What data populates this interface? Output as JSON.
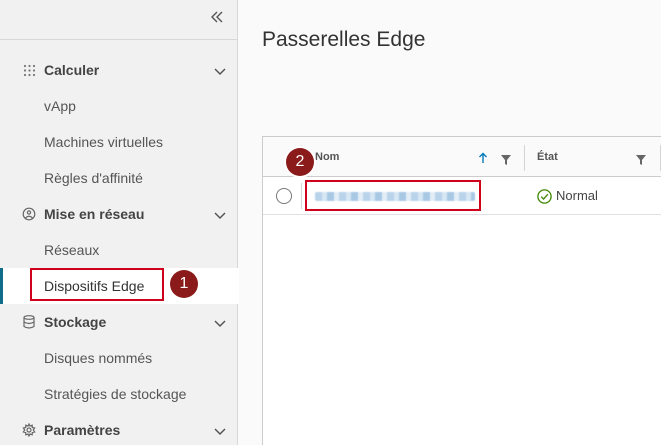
{
  "sidebar": {
    "collapse_icon": "double-chevron-left-icon",
    "groups": [
      {
        "label": "Calculer",
        "icon": "grid-icon",
        "items": [
          {
            "label": "vApp"
          },
          {
            "label": "Machines virtuelles"
          },
          {
            "label": "Règles d'affinité"
          }
        ]
      },
      {
        "label": "Mise en réseau",
        "icon": "network-icon",
        "items": [
          {
            "label": "Réseaux"
          },
          {
            "label": "Dispositifs Edge",
            "active": true
          }
        ]
      },
      {
        "label": "Stockage",
        "icon": "database-icon",
        "items": [
          {
            "label": "Disques nommés"
          },
          {
            "label": "Stratégies de stockage"
          }
        ]
      },
      {
        "label": "Paramètres",
        "icon": "gear-icon",
        "items": []
      }
    ]
  },
  "main": {
    "title": "Passerelles Edge",
    "grid": {
      "columns": [
        {
          "label": "Nom",
          "sort": "ascending",
          "filter": true
        },
        {
          "label": "État",
          "filter": true
        }
      ],
      "rows": [
        {
          "name": "",
          "status": "Normal",
          "status_color": "#3c8500"
        }
      ]
    }
  },
  "annotations": [
    {
      "label": "1"
    },
    {
      "label": "2"
    }
  ],
  "colors": {
    "accent": "#0079b8",
    "active_bar": "#0f6d8a",
    "annotation": "#d0021b",
    "badge": "#8b1a1a"
  }
}
